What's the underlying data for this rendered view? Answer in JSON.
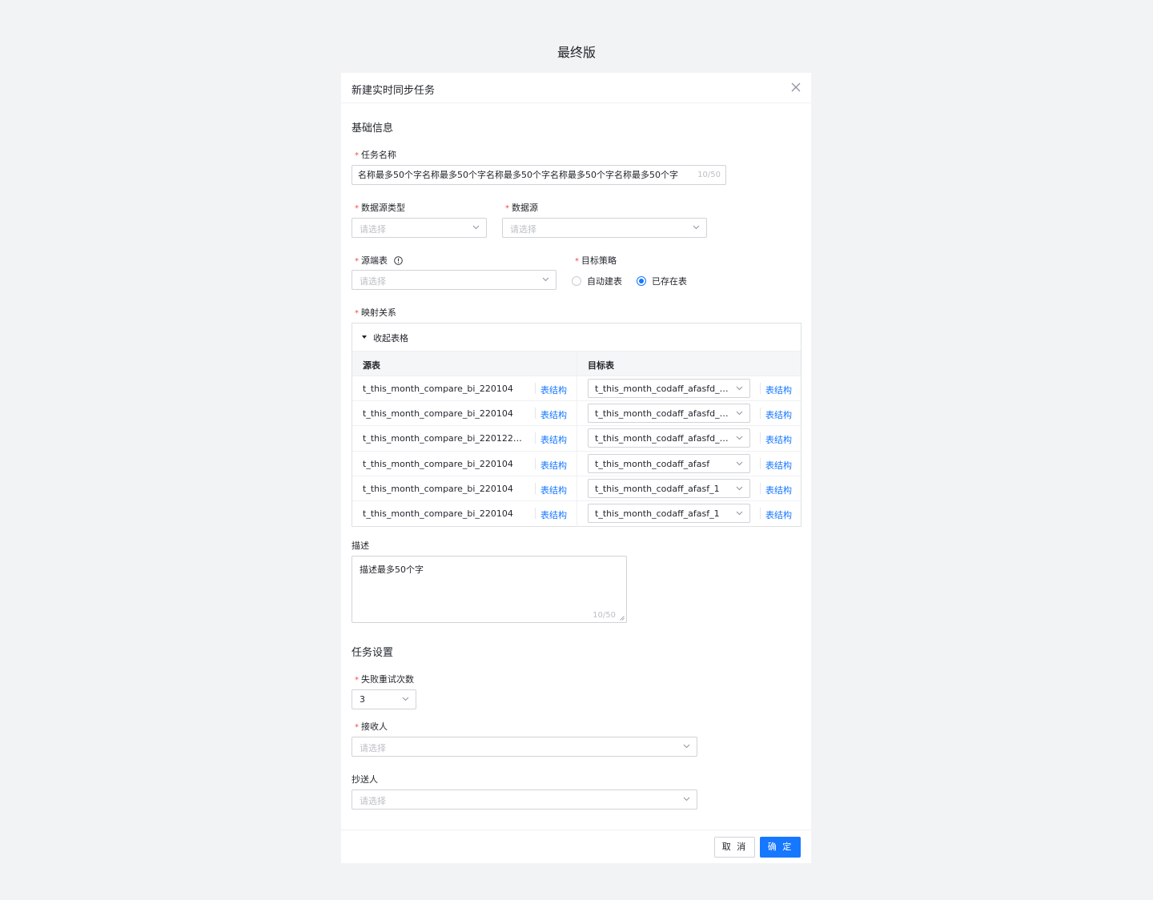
{
  "page_heading": "最终版",
  "modal": {
    "title": "新建实时同步任务"
  },
  "basic": {
    "section_title": "基础信息",
    "task_name": {
      "label": "任务名称",
      "value": "名称最多50个字名称最多50个字名称最多50个字名称最多50个字名称最多50个字",
      "counter": "10/50"
    },
    "datasource_type": {
      "label": "数据源类型",
      "placeholder": "请选择"
    },
    "datasource": {
      "label": "数据源",
      "placeholder": "请选择"
    },
    "source_table": {
      "label": "源端表",
      "placeholder": "请选择"
    },
    "target_strategy": {
      "label": "目标策略",
      "options": [
        {
          "label": "自动建表",
          "checked": false
        },
        {
          "label": "已存在表",
          "checked": true
        }
      ]
    },
    "mapping": {
      "label": "映射关系",
      "collapse_label": "收起表格",
      "columns": [
        "源表",
        "目标表"
      ],
      "rows": [
        {
          "source": "t_this_month_compare_bi_220104",
          "source_link": "表结构",
          "target": "t_this_month_codaff_afasfd_fd...",
          "target_link": "表结构"
        },
        {
          "source": "t_this_month_compare_bi_220104",
          "source_link": "表结构",
          "target": "t_this_month_codaff_afasfd_fd...",
          "target_link": "表结构"
        },
        {
          "source": "t_this_month_compare_bi_220122322...",
          "source_link": "表结构",
          "target": "t_this_month_codaff_afasfd_fd...",
          "target_link": "表结构"
        },
        {
          "source": "t_this_month_compare_bi_220104",
          "source_link": "表结构",
          "target": "t_this_month_codaff_afasf",
          "target_link": "表结构"
        },
        {
          "source": "t_this_month_compare_bi_220104",
          "source_link": "表结构",
          "target": "t_this_month_codaff_afasf_1",
          "target_link": "表结构"
        },
        {
          "source": "t_this_month_compare_bi_220104",
          "source_link": "表结构",
          "target": "t_this_month_codaff_afasf_1",
          "target_link": "表结构"
        }
      ]
    },
    "description": {
      "label": "描述",
      "value": "描述最多50个字",
      "counter": "10/50"
    }
  },
  "task_settings": {
    "section_title": "任务设置",
    "retry": {
      "label": "失败重试次数",
      "value": "3"
    },
    "receiver": {
      "label": "接收人",
      "placeholder": "请选择"
    },
    "cc": {
      "label": "抄送人",
      "placeholder": "请选择"
    }
  },
  "footer": {
    "cancel_label": "取 消",
    "ok_label": "确 定"
  },
  "colors": {
    "primary": "#1677ff",
    "required": "#f54a45",
    "background": "#f2f3f5"
  }
}
